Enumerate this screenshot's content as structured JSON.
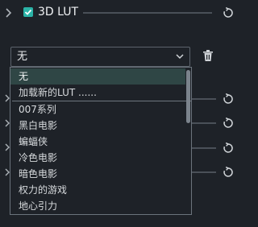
{
  "section": {
    "title": "3D LUT",
    "enabled": true
  },
  "lut_select": {
    "value": "无",
    "options": [
      "无",
      "加载新的LUT ......",
      "007系列",
      "黑白电影",
      "蝙蝠侠",
      "冷色电影",
      "暗色电影",
      "权力的游戏",
      "地心引力"
    ],
    "selected_index": 0
  },
  "icons": {
    "expand": "chevron-right-icon",
    "checkbox": "checkmark-icon",
    "reset": "reset-icon",
    "dropdown": "chevron-down-icon",
    "delete": "trash-icon"
  },
  "colors": {
    "background": "#1e2228",
    "accent": "#2bb3a7",
    "selected_row": "#2f4645"
  }
}
